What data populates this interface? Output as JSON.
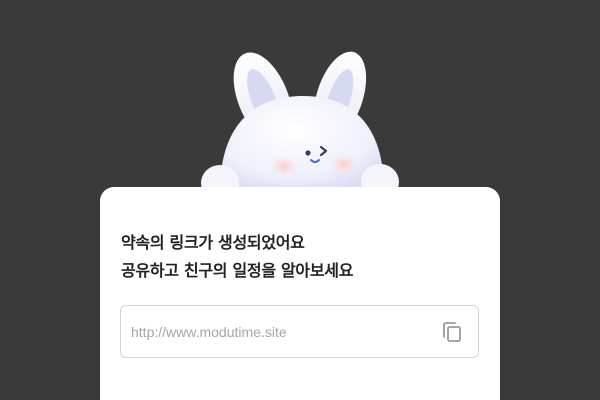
{
  "modal": {
    "title_line1": "약속의 링크가 생성되었어요",
    "title_line2": "공유하고 친구의 일정을 알아보세요",
    "link_value": "http://www.modutime.site"
  },
  "icons": {
    "mascot": "rabbit-mascot",
    "copy": "copy-icon"
  },
  "colors": {
    "backdrop": "#3a3a3a",
    "card": "#ffffff",
    "field_border": "#d4d4d8",
    "title": "#222222",
    "link_text": "#a4a4aa",
    "icon": "#9a9aa0"
  }
}
